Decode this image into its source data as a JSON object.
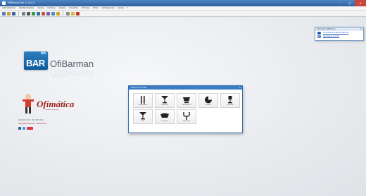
{
  "window": {
    "title": "OfiBarman Ver. 5.19.0.0",
    "buttons": {
      "minimize": "–",
      "maximize": "□",
      "close": "✕"
    }
  },
  "menubar": {
    "items": [
      "Administración",
      "Mantenimientos",
      "Ventas",
      "Compras",
      "Ajustes",
      "Consultas",
      "Informes",
      "Útiles",
      "Configuración",
      "Ayuda",
      "?"
    ]
  },
  "toolbar": {
    "buttons": [
      "new-icon",
      "open-icon",
      "save-icon",
      "search-icon",
      "print-icon",
      "cash-icon",
      "sales-icon",
      "purchases-icon",
      "stock-icon",
      "report-icon",
      "chart-icon",
      "settings-icon",
      "help-icon",
      "exit-icon"
    ]
  },
  "brand": {
    "logo_small": "Ofi",
    "logo_big": "BAR",
    "name": "OfiBarman"
  },
  "vendor": {
    "logo": "Ofimática",
    "tagline": "software de gestión",
    "line1": "900 000 000 · 000 000 000",
    "line2": "info@ofimatica.es · www.ofi.es",
    "social": [
      "facebook-icon",
      "twitter-icon",
      "youtube-icon"
    ]
  },
  "dialog": {
    "title": "Selección de TPV",
    "close": "✕",
    "tiles": [
      {
        "label": "Restaurante",
        "icon": "cutlery-icon"
      },
      {
        "label": "Discoteca",
        "icon": "cocktail-icon"
      },
      {
        "label": "Cafetería Pro",
        "icon": "coffee-cup-icon"
      },
      {
        "label": "Pizzería",
        "icon": "pizza-icon"
      },
      {
        "label": "Cafetería",
        "icon": "wine-glass-icon"
      },
      {
        "label": "Pub",
        "icon": "martini-icon"
      },
      {
        "label": "Lunchería",
        "icon": "bowl-icon"
      },
      {
        "label": "Hostelería",
        "icon": "fork-icon"
      }
    ]
  },
  "popup": {
    "title": "Información OfiBarman",
    "close": "✕",
    "links": [
      "Conéctese a Asistencia Remota",
      "Novedades 5.19.0.0"
    ]
  },
  "colors": {
    "accent": "#3d7cc4",
    "vendor_red": "#a0231f",
    "brand_blue": "#0f5c9c"
  }
}
